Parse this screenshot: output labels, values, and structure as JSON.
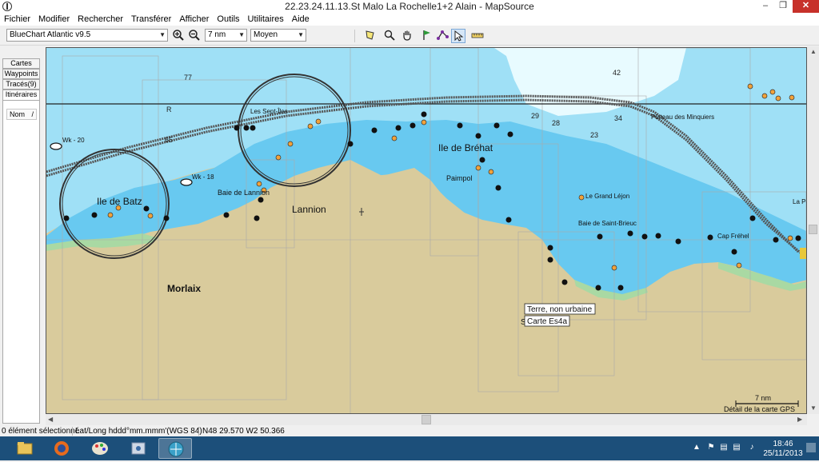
{
  "window": {
    "title": "22.23.24.11.13.St Malo La Rochelle1+2  Alain  - MapSource"
  },
  "menu": [
    "Fichier",
    "Modifier",
    "Rechercher",
    "Transférer",
    "Afficher",
    "Outils",
    "Utilitaires",
    "Aide"
  ],
  "toolbar": {
    "map_product": "BlueChart Atlantic v9.5",
    "zoom_scale": "7 nm",
    "detail_level": "Moyen",
    "icons": [
      "zoom-in-icon",
      "zoom-out-icon",
      "select-map-icon",
      "zoom-tool-icon",
      "hand-pan-icon",
      "waypoint-flag-icon",
      "route-tool-icon",
      "pointer-icon",
      "measure-icon"
    ]
  },
  "left_panel": {
    "tabs": [
      "Cartes",
      "Waypoints",
      "Tracés(9)",
      "Itinéraires"
    ],
    "active_tab": "Itinéraires",
    "column_header": "Nom"
  },
  "map": {
    "depth_labels": [
      "77",
      "42",
      "R",
      "65",
      "29",
      "28",
      "34",
      "23"
    ],
    "place_labels": {
      "ile_de_batz": "Ile de Batz",
      "lannion": "Lannion",
      "morlaix": "Morlaix",
      "ile_de_brehat": "Ile de Bréhat",
      "paimpol": "Paimpol",
      "baie_de_lannion": "Baie de Lannion",
      "sept_iles": "Les Sept-Îles",
      "le_grand_lejon": "Le Grand Léjon",
      "baie_de_saint_brieuc": "Baie de Saint-Brieuc",
      "cap_frehel": "Cap Fréhel",
      "plateau_des_minquiers": "Plateau des Minquiers",
      "la_pe": "La Pe",
      "wk_20": "Wk - 20",
      "wk_18": "Wk - 18",
      "wk_left": "Wk",
      "s_partial": "S"
    },
    "tooltip": {
      "line1": "Terre, non urbaine",
      "line2": "Carte Es4a"
    },
    "scale_bar": {
      "label": "7 nm",
      "caption": "Détail de la carte GPS"
    },
    "colors": {
      "land": "#d9cb9c",
      "shallow": "#68c9f0",
      "mid": "#9fe0f6",
      "deep": "#e8fbff",
      "intertidal": "#a9d9a3",
      "track": "#4a4a4a"
    }
  },
  "status": {
    "selection": "0 élément sélectionné",
    "format": "Lat/Long hddd°mm.mmm'(WGS 84)",
    "position": "N48 29.570 W2 50.366"
  },
  "taskbar": {
    "apps": [
      "file-explorer-icon",
      "firefox-icon",
      "paint-icon",
      "media-icon",
      "mapsource-icon"
    ],
    "time": "18:46",
    "date": "25/11/2013"
  }
}
